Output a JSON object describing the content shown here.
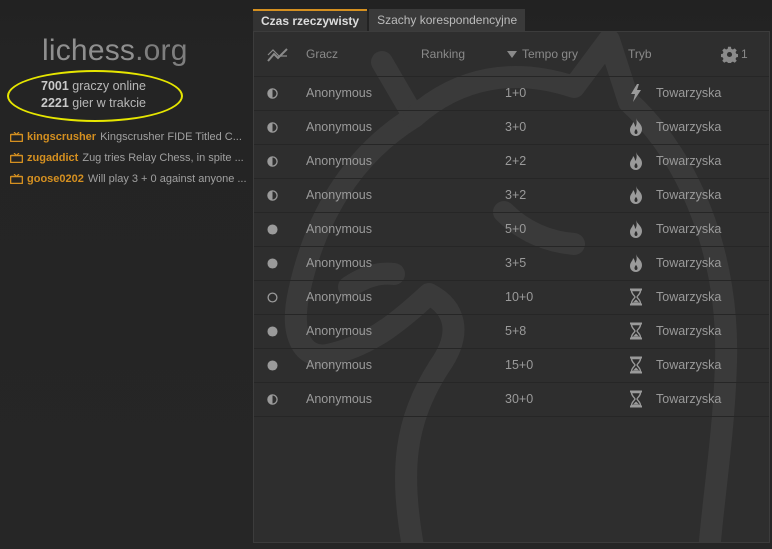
{
  "logo": {
    "main": "lichess",
    "suffix": ".org"
  },
  "online": {
    "players_count": "7001",
    "players_label": "graczy online",
    "games_count": "2221",
    "games_label": "gier w trakcie"
  },
  "streamers": [
    {
      "name": "kingscrusher",
      "title": "Kingscrusher FIDE Titled C..."
    },
    {
      "name": "zugaddict",
      "title": "Zug tries Relay Chess, in spite ..."
    },
    {
      "name": "goose0202",
      "title": "Will play 3 + 0 against anyone ..."
    }
  ],
  "tabs": [
    {
      "label": "Czas rzeczywisty",
      "active": true
    },
    {
      "label": "Szachy korespondencyjne",
      "active": false
    }
  ],
  "table": {
    "headers": {
      "player": "Gracz",
      "rating": "Ranking",
      "time": "Tempo gry",
      "mode": "Tryb",
      "filter_count": "1"
    },
    "rows": [
      {
        "icon": "half-circle-icon",
        "player": "Anonymous",
        "time": "1+0",
        "mode_icon": "bullet-icon",
        "mode": "Towarzyska"
      },
      {
        "icon": "half-circle-icon",
        "player": "Anonymous",
        "time": "3+0",
        "mode_icon": "blitz-icon",
        "mode": "Towarzyska"
      },
      {
        "icon": "half-circle-icon",
        "player": "Anonymous",
        "time": "2+2",
        "mode_icon": "blitz-icon",
        "mode": "Towarzyska"
      },
      {
        "icon": "half-circle-icon",
        "player": "Anonymous",
        "time": "3+2",
        "mode_icon": "blitz-icon",
        "mode": "Towarzyska"
      },
      {
        "icon": "full-circle-icon",
        "player": "Anonymous",
        "time": "5+0",
        "mode_icon": "blitz-icon",
        "mode": "Towarzyska"
      },
      {
        "icon": "full-circle-icon",
        "player": "Anonymous",
        "time": "3+5",
        "mode_icon": "blitz-icon",
        "mode": "Towarzyska"
      },
      {
        "icon": "empty-circle-icon",
        "player": "Anonymous",
        "time": "10+0",
        "mode_icon": "classical-icon",
        "mode": "Towarzyska"
      },
      {
        "icon": "full-circle-icon",
        "player": "Anonymous",
        "time": "5+8",
        "mode_icon": "classical-icon",
        "mode": "Towarzyska"
      },
      {
        "icon": "full-circle-icon",
        "player": "Anonymous",
        "time": "15+0",
        "mode_icon": "classical-icon",
        "mode": "Towarzyska"
      },
      {
        "icon": "half-circle-icon",
        "player": "Anonymous",
        "time": "30+0",
        "mode_icon": "classical-icon",
        "mode": "Towarzyska"
      }
    ]
  },
  "colors": {
    "accent": "#d59020",
    "highlight_oval": "#e6e600",
    "panel": "#2e2e2e"
  }
}
